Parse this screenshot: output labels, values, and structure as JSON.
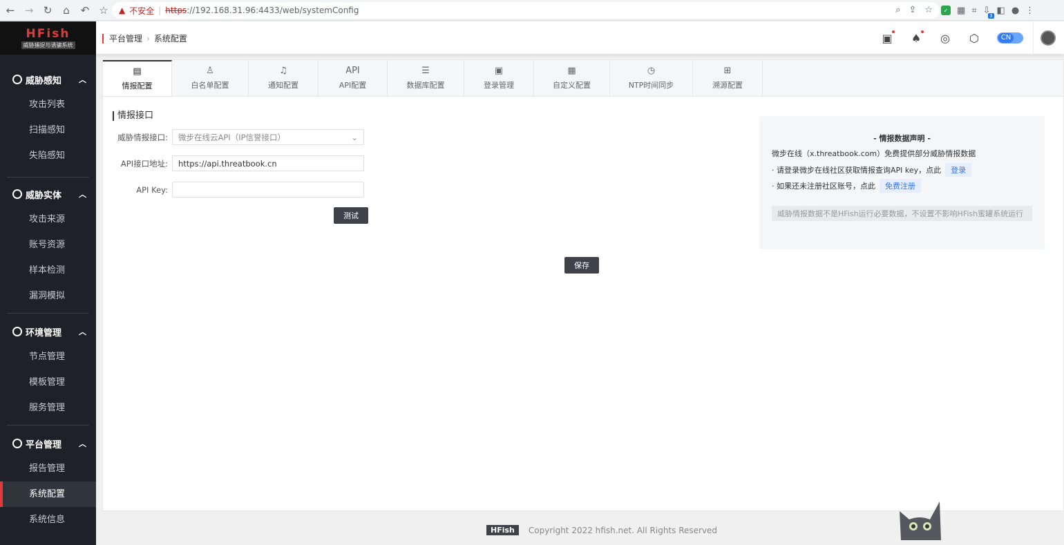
{
  "browser": {
    "insecure_label": "不安全",
    "url_scheme": "https",
    "url_rest": "://192.168.31.96:4433/web/systemConfig",
    "ext_badge": "3"
  },
  "sidebar": {
    "logo_title": "HFish",
    "logo_subtitle": "威胁捕捉与诱骗系统",
    "groups": [
      {
        "title": "威胁感知",
        "items": [
          "攻击列表",
          "扫描感知",
          "失陷感知"
        ]
      },
      {
        "title": "威胁实体",
        "items": [
          "攻击来源",
          "账号资源",
          "样本检测",
          "漏洞模拟"
        ]
      },
      {
        "title": "环境管理",
        "items": [
          "节点管理",
          "模板管理",
          "服务管理"
        ]
      },
      {
        "title": "平台管理",
        "items": [
          "报告管理",
          "系统配置",
          "系统信息"
        ]
      }
    ]
  },
  "header": {
    "breadcrumb": [
      "平台管理",
      "系统配置"
    ],
    "lang": "CN"
  },
  "tabs": [
    {
      "label": "情报配置",
      "icon": "book-icon"
    },
    {
      "label": "白名单配置",
      "icon": "user-icon"
    },
    {
      "label": "通知配置",
      "icon": "bell-icon"
    },
    {
      "label": "API配置",
      "icon_text": "API"
    },
    {
      "label": "数据库配置",
      "icon": "list-icon"
    },
    {
      "label": "登录管理",
      "icon": "login-icon"
    },
    {
      "label": "自定义配置",
      "icon": "grid-icon"
    },
    {
      "label": "NTP时间同步",
      "icon": "clock-icon"
    },
    {
      "label": "溯源配置",
      "icon": "network-icon"
    }
  ],
  "form": {
    "section_title": "情报接口",
    "intel_label": "威胁情报接口:",
    "intel_value": "微步在线云API（IP信誉接口）",
    "api_url_label": "API接口地址:",
    "api_url_value": "https://api.threatbook.cn",
    "api_key_label": "API Key:",
    "api_key_value": "",
    "test_button": "测试",
    "save_button": "保存"
  },
  "notice": {
    "title": "- 情报数据声明 -",
    "line1": "微步在线（x.threatbook.com）免费提供部分威胁情报数据",
    "line2": "· 请登录微步在线社区获取情报查询API key，点此",
    "line2_link": "登录",
    "line3": "· 如果还未注册社区账号，点此",
    "line3_link": "免费注册",
    "tip": "威胁情报数据不是HFish运行必要数据，不设置不影响HFish蜜罐系统运行"
  },
  "footer": {
    "logo": "HFish",
    "copyright": "Copyright 2022 hfish.net. All Rights Reserved"
  }
}
